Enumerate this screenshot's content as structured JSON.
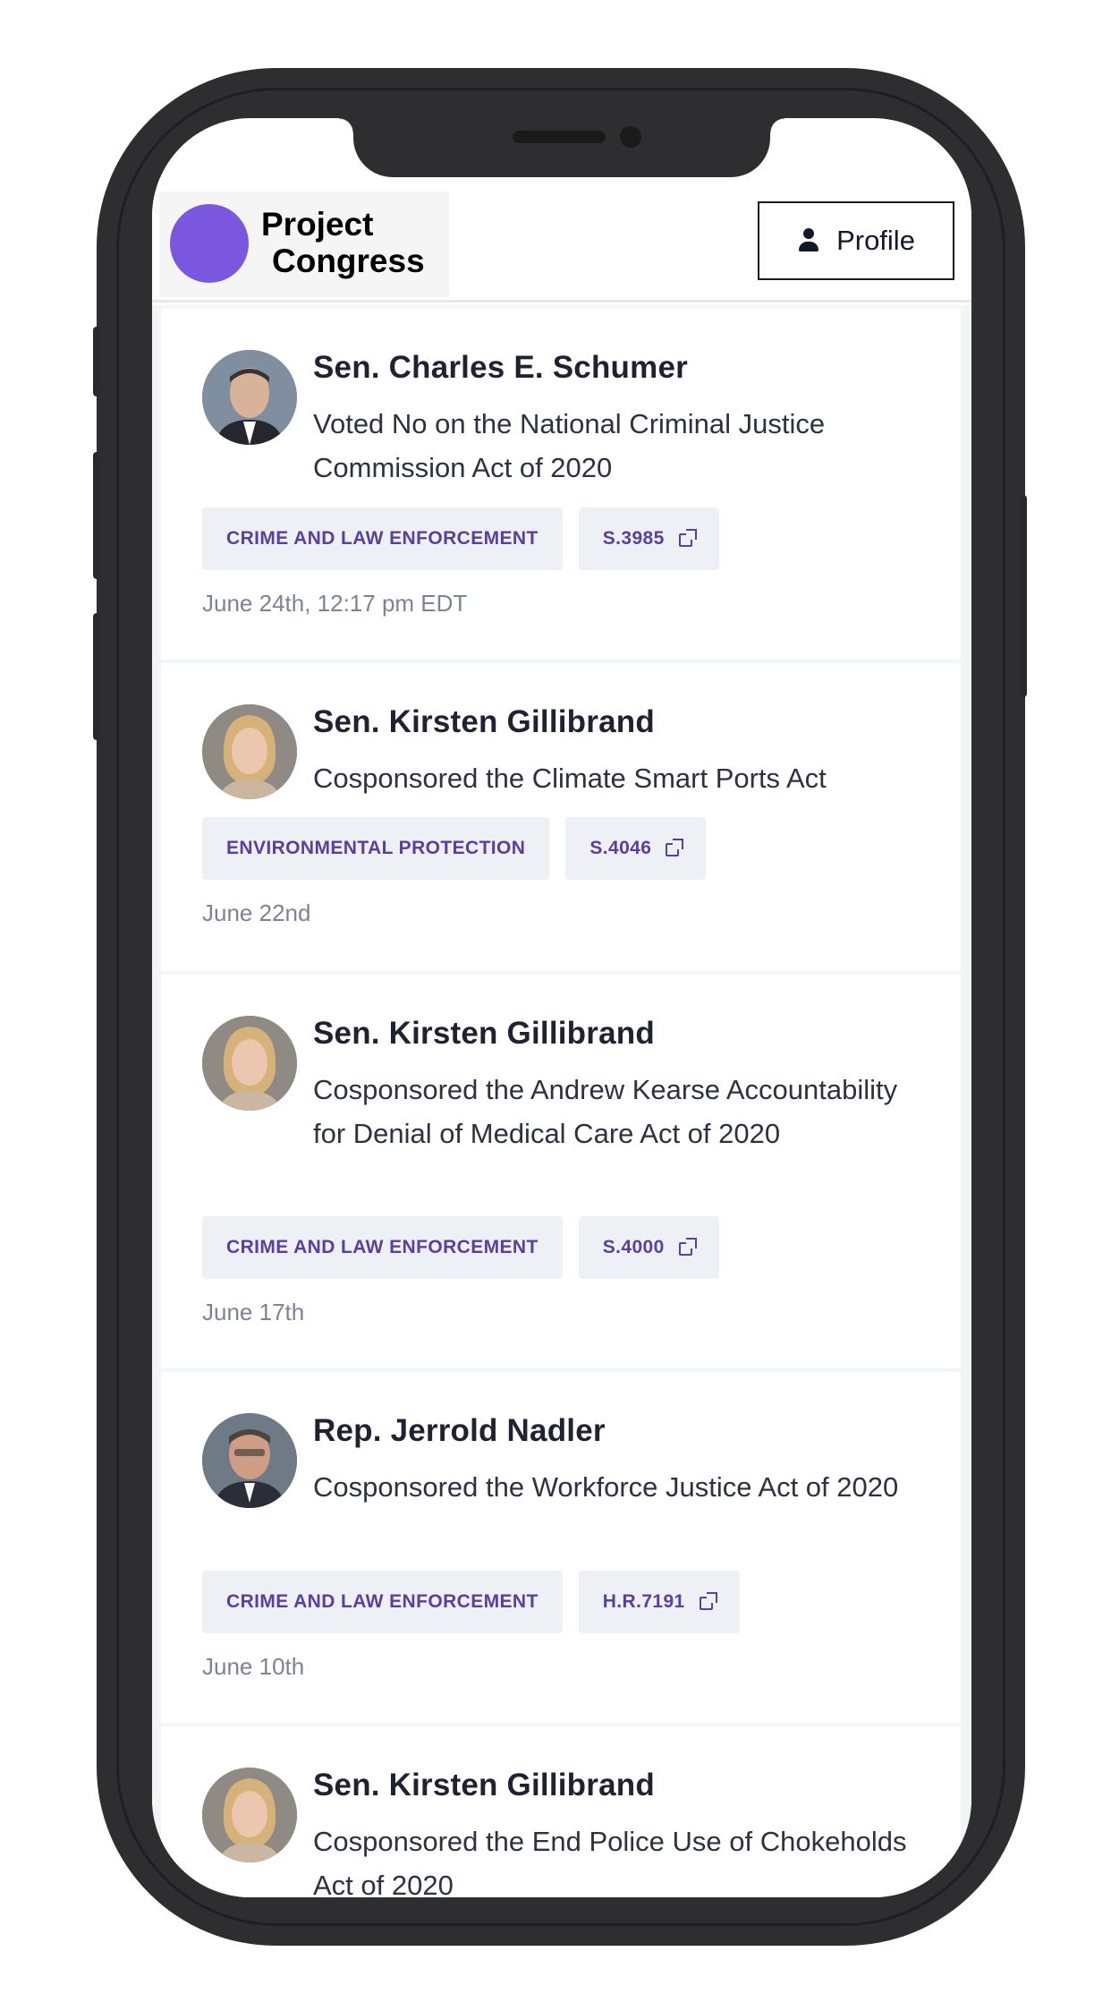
{
  "header": {
    "logo_line1": "Project",
    "logo_line2": "Congress",
    "profile_label": "Profile"
  },
  "feed": [
    {
      "name": "Sen. Charles E. Schumer",
      "action": "Voted No on the National Criminal Justice Commission Act of 2020",
      "topic": "CRIME AND LAW ENFORCEMENT",
      "bill": "S.3985",
      "date": "June 24th, 12:17 pm EDT"
    },
    {
      "name": "Sen. Kirsten Gillibrand",
      "action": "Cosponsored the Climate Smart Ports Act",
      "topic": "ENVIRONMENTAL PROTECTION",
      "bill": "S.4046",
      "date": "June 22nd"
    },
    {
      "name": "Sen. Kirsten Gillibrand",
      "action": "Cosponsored the Andrew Kearse Accountability for Denial of Medical Care Act of 2020",
      "topic": "CRIME AND LAW ENFORCEMENT",
      "bill": "S.4000",
      "date": "June 17th"
    },
    {
      "name": "Rep. Jerrold Nadler",
      "action": "Cosponsored the Workforce Justice Act of 2020",
      "topic": "CRIME AND LAW ENFORCEMENT",
      "bill": "H.R.7191",
      "date": "June 10th"
    },
    {
      "name": "Sen. Kirsten Gillibrand",
      "action": "Cosponsored the End Police Use of Chokeholds Act of 2020"
    }
  ],
  "colors": {
    "brand": "#7b57e0",
    "tag_text": "#5a3f9c",
    "tag_bg": "#edf1f6",
    "device": "#2e2e30"
  }
}
